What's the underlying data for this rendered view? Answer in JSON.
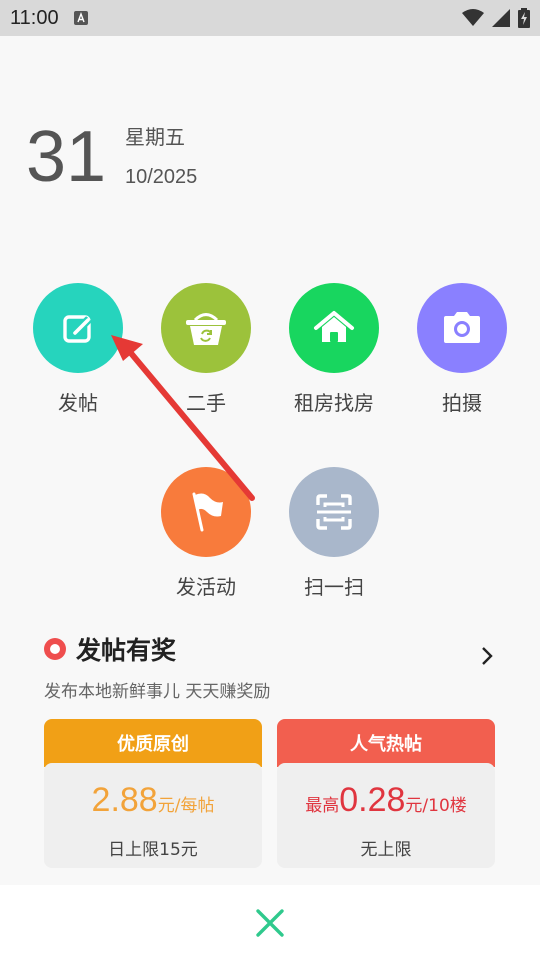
{
  "status_bar": {
    "time": "11:00"
  },
  "date": {
    "day": "31",
    "weekday": "星期五",
    "month_year": "10/2025"
  },
  "actions": [
    {
      "label": "发帖",
      "icon": "edit-icon",
      "color": "#26d4bd"
    },
    {
      "label": "二手",
      "icon": "basket-icon",
      "color": "#9cc23b"
    },
    {
      "label": "租房找房",
      "icon": "house-icon",
      "color": "#18d65f"
    },
    {
      "label": "拍摄",
      "icon": "camera-icon",
      "color": "#8a80ff"
    },
    {
      "label": "发活动",
      "icon": "flag-icon",
      "color": "#f87b3c"
    },
    {
      "label": "扫一扫",
      "icon": "scan-icon",
      "color": "#a9b7cb"
    }
  ],
  "reward": {
    "title": "发帖有奖",
    "subtitle": "发布本地新鲜事儿 天天赚奖励",
    "cards": [
      {
        "header": "优质原创",
        "header_color": "#f1a016",
        "prefix": "",
        "amount": "2.88",
        "unit": "元/每帖",
        "amount_color": "#f2a33a",
        "limit": "日上限15元"
      },
      {
        "header": "人气热帖",
        "header_color": "#f25f4f",
        "prefix": "最高",
        "amount": "0.28",
        "unit": "元/10楼",
        "amount_color": "#e0353f",
        "limit": "无上限"
      }
    ]
  },
  "close_icon_color": "#2fc98d"
}
